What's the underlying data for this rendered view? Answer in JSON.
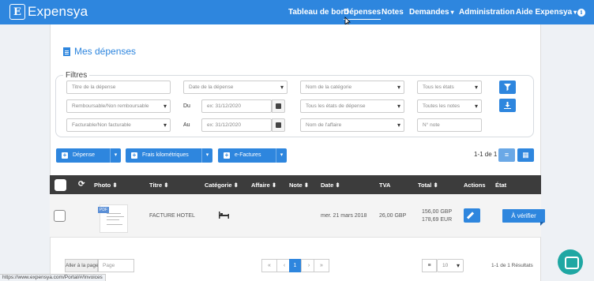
{
  "app": {
    "brand": "Expensya",
    "logo_letter": "E"
  },
  "nav": {
    "tableau": "Tableau de bord",
    "depenses": "Dépenses",
    "notes": "Notes",
    "demandes": "Demandes",
    "administration": "Administration",
    "aide": "Aide Expensya",
    "chevron": "▾",
    "info": "i"
  },
  "page": {
    "title": "Mes dépenses"
  },
  "filters": {
    "legend": "Filtres",
    "titre": "Titre de la dépense",
    "date": "Date de la dépense",
    "categorie": "Nom de la catégorie",
    "etats": "Tous les états",
    "remboursable": "Remboursable/Non remboursable",
    "du_label": "Du",
    "du_value": "ex: 31/12/2020",
    "etats_depense": "Tous les états de dépense",
    "toutes_notes": "Toutes les notes",
    "facturable": "Facturable/Non facturable",
    "au_label": "Au",
    "au_value": "ex: 31/12/2020",
    "affaire": "Nom de l'affaire",
    "num_note": "N° note"
  },
  "actions": {
    "depense": "Dépense",
    "frais_km": "Frais kilométriques",
    "efactures": "e-Factures",
    "count": "1-1 de 1"
  },
  "table": {
    "headers": {
      "photo": "Photo ⬍",
      "titre": "Titre ⬍",
      "categorie": "Catégorie ⬍",
      "affaire": "Affaire ⬍",
      "note": "Note ⬍",
      "date": "Date ⬍",
      "tva": "TVA",
      "total": "Total ⬍",
      "actions": "Actions",
      "etat": "État"
    },
    "rows": [
      {
        "pdf_tag": "PDF",
        "titre": "FACTURE HOTEL",
        "date": "mer. 21 mars 2018",
        "tva": "26,00 GBP",
        "total_primary": "156,00 GBP",
        "total_secondary": "178,69 EUR",
        "etat": "À vérifier"
      }
    ]
  },
  "pagination": {
    "goto_label": "Aller à la page",
    "goto_placeholder": "Page",
    "first": "«",
    "prev": "‹",
    "current": "1",
    "next": "›",
    "last": "»",
    "page_size": "10",
    "results": "1-1 de 1 Résultats"
  },
  "statusbar": {
    "url": "https://www.expensya.com/Portal/#/Invoices"
  },
  "colors": {
    "primary": "#2e86de",
    "header_dark": "#3c3c3c",
    "chat": "#1fa7a3"
  }
}
